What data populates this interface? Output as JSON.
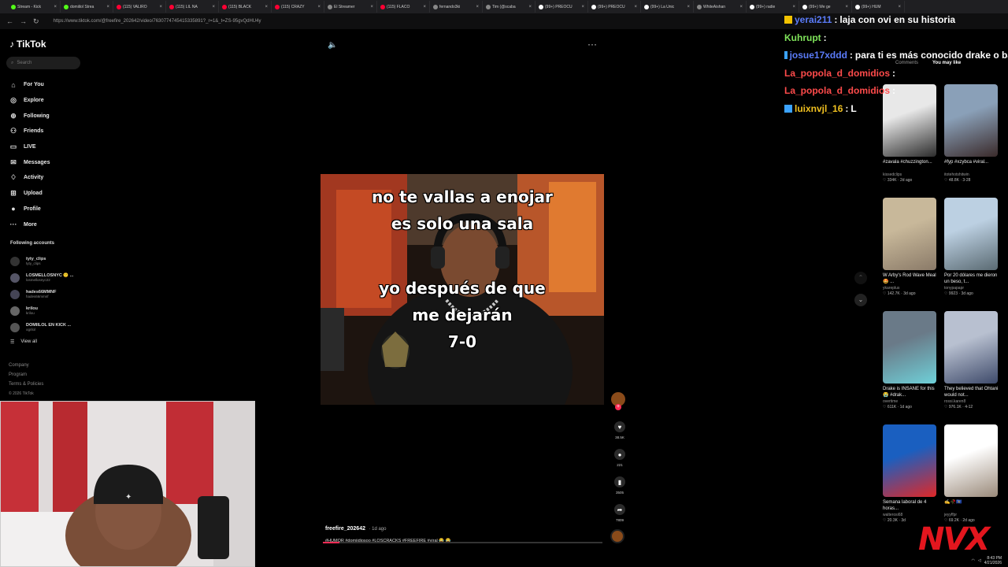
{
  "browser": {
    "tabs": [
      {
        "label": "Stream - Kick",
        "color": "#53fc18"
      },
      {
        "label": "domiilol Strea",
        "color": "#53fc18"
      },
      {
        "label": "(115) VALIRO",
        "color": "#ff0033"
      },
      {
        "label": "(115) LIL NA",
        "color": "#ff0033"
      },
      {
        "label": "(115) BLACK",
        "color": "#ff0033"
      },
      {
        "label": "(115) CRAZY",
        "color": "#ff0033"
      },
      {
        "label": "El Streamer",
        "color": "#888888"
      },
      {
        "label": "(115) FLACO",
        "color": "#ff0033"
      },
      {
        "label": "fernando3ki",
        "color": "#888888"
      },
      {
        "label": "Tim (@scaba",
        "color": "#888888"
      },
      {
        "label": "(99+) PREOCU",
        "color": "#ffffff"
      },
      {
        "label": "(99+) PREOCU",
        "color": "#ffffff"
      },
      {
        "label": "(99+) La Unic",
        "color": "#ffffff"
      },
      {
        "label": "WhiteAishan",
        "color": "#888888"
      },
      {
        "label": "(99+) radie",
        "color": "#ffffff"
      },
      {
        "label": "(99+) We ge",
        "color": "#ffffff"
      },
      {
        "label": "(99+) HUM",
        "color": "#ffffff"
      }
    ],
    "url": "https://www.tiktok.com/@freefire_202642/video/7630774745415335891?_r=1&_t=ZS-95gvQdHU4y"
  },
  "sidebar": {
    "logo": "TikTok",
    "search_placeholder": "Search",
    "nav": [
      {
        "label": "For You",
        "icon": "home-icon",
        "glyph": "⌂"
      },
      {
        "label": "Explore",
        "icon": "compass-icon",
        "glyph": "◎"
      },
      {
        "label": "Following",
        "icon": "following-icon",
        "glyph": "⊕"
      },
      {
        "label": "Friends",
        "icon": "friends-icon",
        "glyph": "⚇"
      },
      {
        "label": "LIVE",
        "icon": "live-icon",
        "glyph": "▭"
      },
      {
        "label": "Messages",
        "icon": "messages-icon",
        "glyph": "✉"
      },
      {
        "label": "Activity",
        "icon": "activity-icon",
        "glyph": "♢"
      },
      {
        "label": "Upload",
        "icon": "upload-icon",
        "glyph": "⊞"
      },
      {
        "label": "Profile",
        "icon": "profile-icon",
        "glyph": "●"
      },
      {
        "label": "More",
        "icon": "more-icon",
        "glyph": "···"
      }
    ],
    "following_title": "Following accounts",
    "accounts": [
      {
        "name": "tyty_clips",
        "handle": "tyty_clips",
        "color": "#333"
      },
      {
        "name": "LOSMELLOSNYC 🙂 ...",
        "handle": "losmellosnyc22",
        "color": "#556"
      },
      {
        "name": "hades66MMNF",
        "handle": "hades66mmnf",
        "color": "#445"
      },
      {
        "name": "krilou",
        "handle": "krilou",
        "color": "#666"
      },
      {
        "name": "DOMIILOL EN KICK ...",
        "handle": "ogrilol",
        "color": "#555"
      }
    ],
    "view_all": "View all",
    "footer": [
      "Company",
      "Program",
      "Terms & Policies"
    ],
    "copyright": "© 2026 TikTok"
  },
  "video": {
    "caption_top": [
      "no te vallas a enojar",
      "es solo una sala"
    ],
    "caption_bottom": [
      "yo después de que",
      "me dejarán",
      "7-0"
    ],
    "username": "freefire_202642",
    "ago": "· 1d ago",
    "hashtags": "#HUMOR #domiidiosoo #LOSCRACKS #FREEFIRE #viral 😂 😂",
    "progress": 0.06,
    "likes": "38.5K",
    "comments": "221",
    "saves": "3505",
    "shares": "7809"
  },
  "chat": [
    {
      "user": "yerai211",
      "sep": " : ",
      "msg": "laja con ovi en su historia",
      "color": "#5b7cfa",
      "badge": "#f2c200"
    },
    {
      "user": "Kuhrupt",
      "sep": " : ",
      "msg": "",
      "color": "#7fe35a",
      "badge": ""
    },
    {
      "user": "josue17xddd",
      "sep": " : ",
      "msg": "para ti es más conocido drake o ba",
      "color": "#5b7cfa",
      "badge": "#3ba3ff"
    },
    {
      "user": "La_popola_d_domidios",
      "sep": " : ",
      "msg": "",
      "color": "#ff4b4b",
      "badge": ""
    },
    {
      "user": "La_popola_d_domidios",
      "sep": " : ",
      "msg": "",
      "color": "#ff4b4b",
      "badge": ""
    },
    {
      "user": "luixnvjl_16",
      "sep": " : ",
      "msg": "L",
      "color": "#f0c020",
      "badge": "#3ba3ff"
    }
  ],
  "panel": {
    "tab_comments": "Comments",
    "tab_you_may_like": "You may like"
  },
  "cards": [
    {
      "title": "#zavala #chuzzington...",
      "user": "kissedclips",
      "views": "334K",
      "date": "2d ago",
      "c1": "#e8e8e8",
      "c2": "#2c2c2c"
    },
    {
      "title": "#fyp #xzybca #viral...",
      "user": "itotehotshitwin",
      "views": "48.8K",
      "date": "3-28",
      "c1": "#8aa0b8",
      "c2": "#3a2a2a"
    },
    {
      "title": "W Arby's Rod Wave Meal 🤩 ...",
      "user": "ykareplus",
      "views": "142.7K",
      "date": "3d ago",
      "c1": "#c8b89a",
      "c2": "#8a7a68"
    },
    {
      "title": "Por 20 dólares me dieron un beso, t...",
      "user": "tonypapapr",
      "views": "9923",
      "date": "3d ago",
      "c1": "#bcd0e2",
      "c2": "#5a6a72"
    },
    {
      "title": "Drake is INSANE for this 😭 #drak...",
      "user": "overtime",
      "views": "611K",
      "date": "1d ago",
      "c1": "#6a7a88",
      "c2": "#6fd0d8"
    },
    {
      "title": "They believed that Ohtani would not...",
      "user": "rossi.karen8",
      "views": "976.1K",
      "date": "4-12",
      "c1": "#b8c0d0",
      "c2": "#3e4a6a"
    },
    {
      "title": "Semana laboral de 4 horas...",
      "user": "walterosi68",
      "views": "20.3K",
      "date": "3d",
      "c1": "#1a5fc0",
      "c2": "#e02828"
    },
    {
      "title": "✍️🥀🇽🇰",
      "user": "jeyyffpr",
      "views": "69.2K",
      "date": "2d ago",
      "c1": "#ffffff",
      "c2": "#9a8a7a"
    }
  ],
  "overlay": {
    "brand": "NVX"
  },
  "taskbar": {
    "time": "8:43 PM",
    "date": "4/21/2026"
  }
}
